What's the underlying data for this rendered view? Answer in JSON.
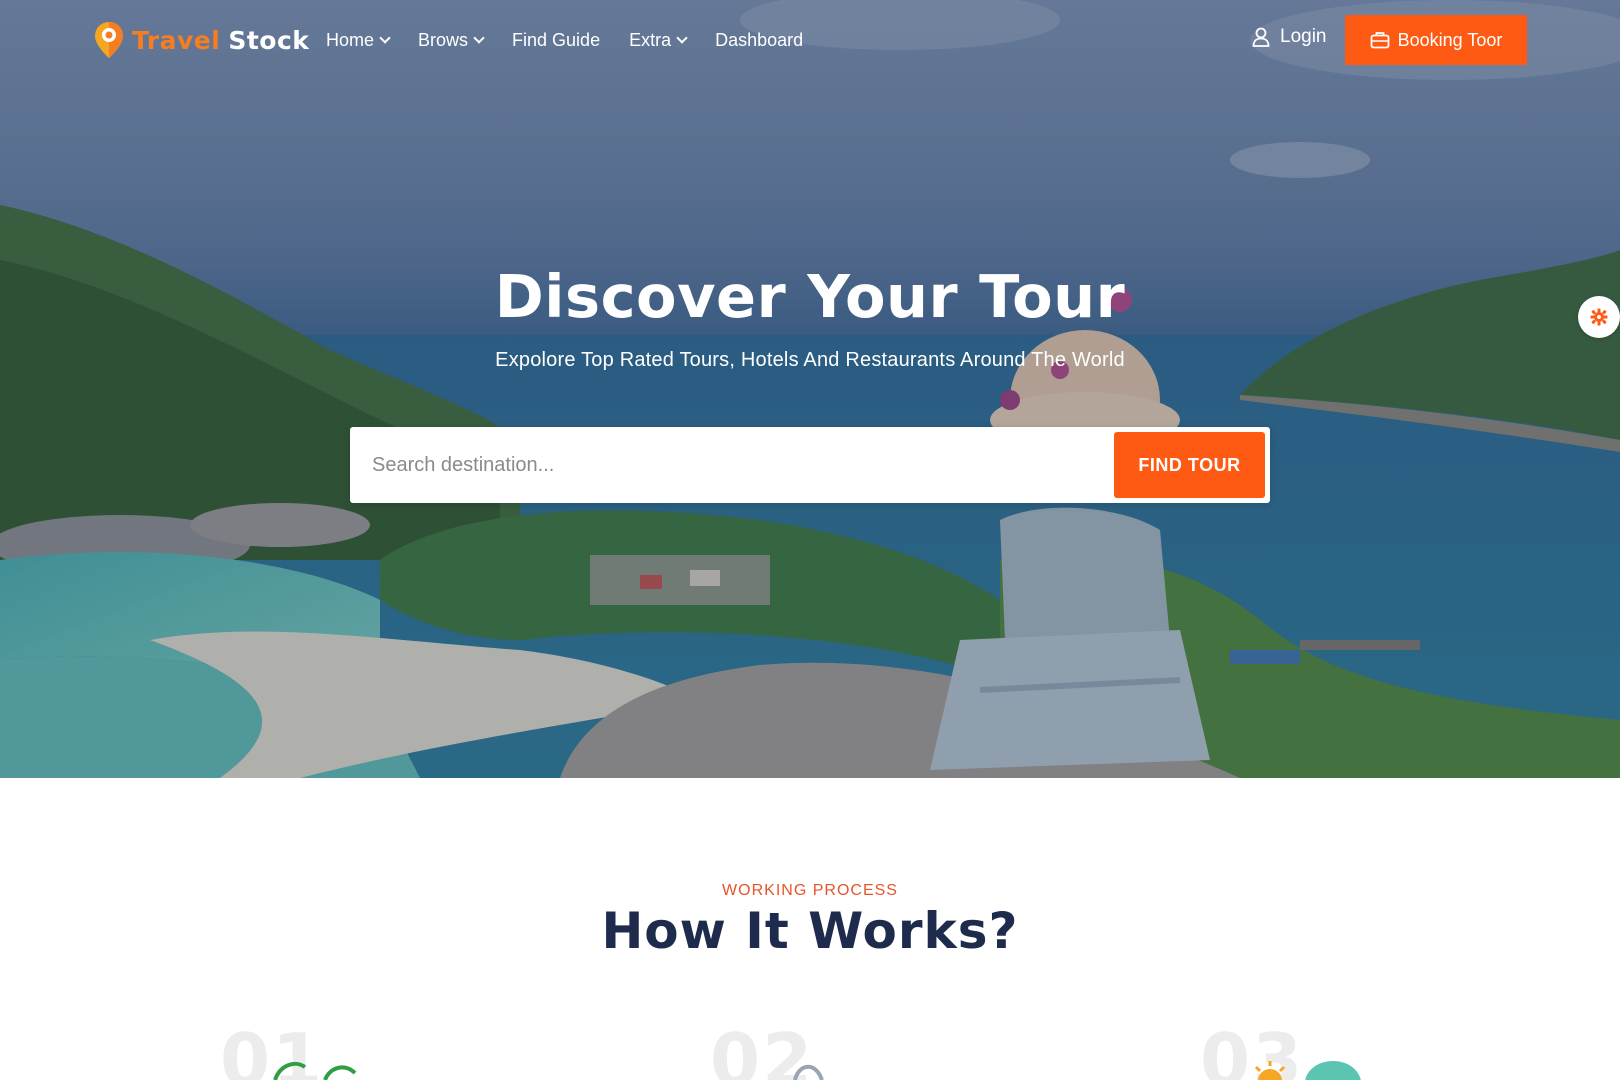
{
  "brand": {
    "name_part1": "Travel",
    "name_part2": "Stock"
  },
  "nav": {
    "items": [
      {
        "label": "Home",
        "has_dropdown": true
      },
      {
        "label": "Brows",
        "has_dropdown": true
      },
      {
        "label": "Find Guide",
        "has_dropdown": false
      },
      {
        "label": "Extra",
        "has_dropdown": true
      },
      {
        "label": "Dashboard",
        "has_dropdown": false
      }
    ],
    "login_label": "Login",
    "booking_label": "Booking Toor"
  },
  "hero": {
    "title": "Discover Your Tour",
    "subtitle": "Expolore Top Rated Tours, Hotels And Restaurants Around The World",
    "search_placeholder": "Search destination...",
    "search_button": "FIND TOUR"
  },
  "how_it_works": {
    "eyebrow": "WORKING PROCESS",
    "title": "How It Works?",
    "steps": [
      {
        "number": "01"
      },
      {
        "number": "02"
      },
      {
        "number": "03"
      }
    ]
  },
  "colors": {
    "accent": "#ff5a14",
    "logo_orange": "#f57d22",
    "heading_navy": "#1e2b4c",
    "eyebrow": "#e8542a"
  },
  "icons": {
    "logo": "map-pin-icon",
    "login": "user-icon",
    "booking": "briefcase-icon",
    "settings": "gear-icon"
  }
}
